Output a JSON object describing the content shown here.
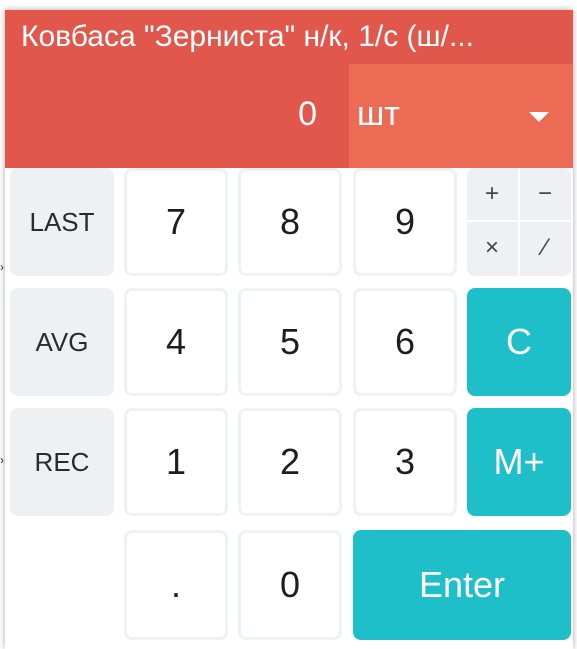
{
  "dialog": {
    "title": "Ковбаса \"Зерниста\" н/к, 1/с (ш/..."
  },
  "input": {
    "quantity": "0",
    "unit": "шт"
  },
  "keypad": {
    "side": {
      "last": "LAST",
      "avg": "AVG",
      "rec": "REC"
    },
    "digits": {
      "d7": "7",
      "d8": "8",
      "d9": "9",
      "d4": "4",
      "d5": "5",
      "d6": "6",
      "d1": "1",
      "d2": "2",
      "d3": "3",
      "dot": ".",
      "d0": "0"
    },
    "ops": {
      "plus": "+",
      "minus": "−",
      "multiply": "×",
      "divide": "⁄"
    },
    "clear": "C",
    "memory_add": "M+",
    "enter": "Enter"
  },
  "colors": {
    "header": "#e2574c",
    "unit_bg": "#ec6b54",
    "accent": "#1fbfc9",
    "side_key": "#eef0f3"
  }
}
